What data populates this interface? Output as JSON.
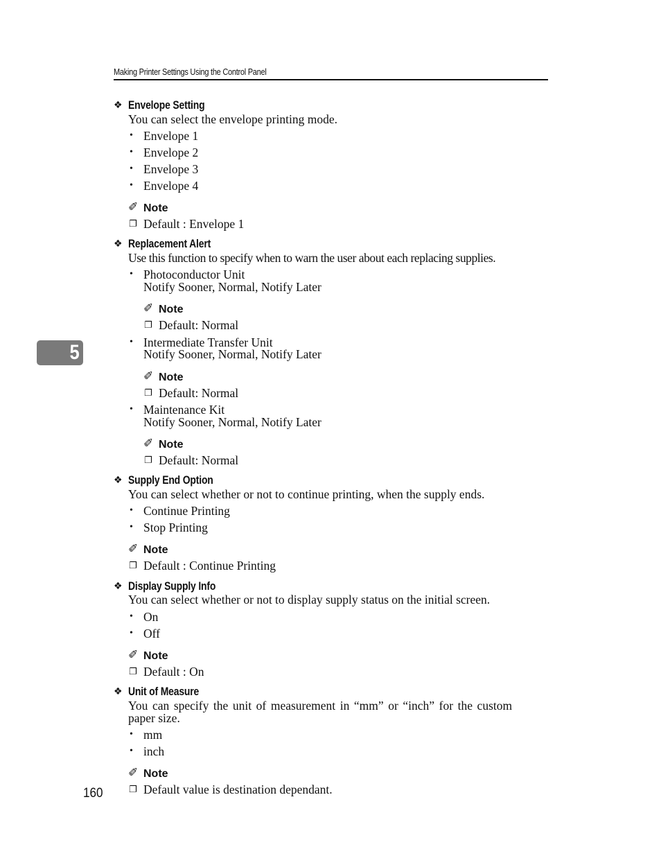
{
  "header": {
    "title": "Making Printer Settings Using the Control Panel"
  },
  "chapter_tab": "5",
  "page_number": "160",
  "icons": {
    "section": "❖",
    "bullet": "•",
    "note": "✐",
    "checkbox": "❐"
  },
  "note_label": "Note",
  "sections": [
    {
      "title": "Envelope Setting",
      "description": "You can select the envelope printing mode.",
      "options": [
        "Envelope 1",
        "Envelope 2",
        "Envelope 3",
        "Envelope 4"
      ],
      "note": "Default : Envelope 1"
    },
    {
      "title": "Replacement Alert",
      "description": "Use this function to specify when to warn the user about each replacing supplies.",
      "items": [
        {
          "name": "Photoconductor Unit",
          "values": "Notify Sooner, Normal, Notify Later",
          "note": "Default: Normal"
        },
        {
          "name": "Intermediate Transfer Unit",
          "values": "Notify Sooner, Normal, Notify Later",
          "note": "Default: Normal"
        },
        {
          "name": "Maintenance Kit",
          "values": "Notify Sooner, Normal, Notify Later",
          "note": "Default: Normal"
        }
      ]
    },
    {
      "title": "Supply End Option",
      "description": "You can select whether or not to continue printing, when the supply ends.",
      "options": [
        "Continue Printing",
        "Stop Printing"
      ],
      "note": "Default : Continue Printing"
    },
    {
      "title": "Display Supply Info",
      "description": "You can select whether or not to display supply status on the initial screen.",
      "options": [
        "On",
        "Off"
      ],
      "note": "Default : On"
    },
    {
      "title": "Unit of Measure",
      "description_line1": "You can specify the unit of measurement in “mm” or “inch” for the custom",
      "description_line2": "paper size.",
      "options": [
        "mm",
        "inch"
      ],
      "note": "Default value is destination dependant."
    }
  ]
}
